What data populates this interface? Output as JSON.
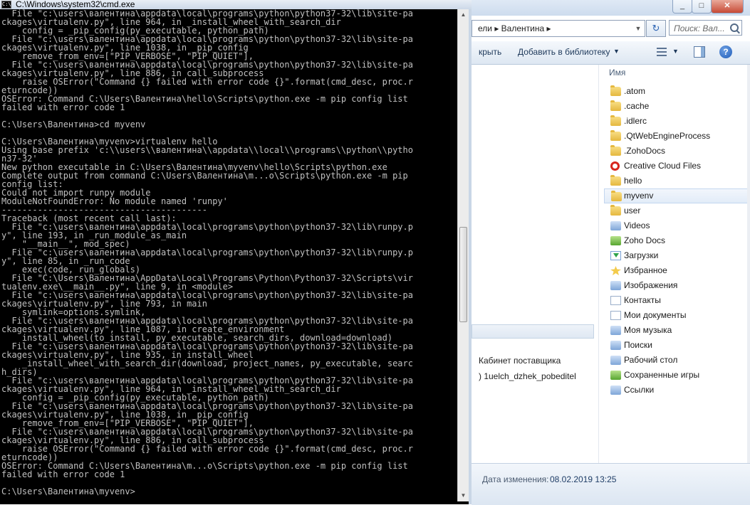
{
  "cmd": {
    "title": "C:\\Windows\\system32\\cmd.exe",
    "icon_label": "C:\\",
    "lines": [
      "  File \"c:\\users\\валентина\\appdata\\local\\programs\\python\\python37-32\\lib\\site-pa",
      "ckages\\virtualenv.py\", line 964, in _install_wheel_with_search_dir",
      "    config = _pip_config(py_executable, python_path)",
      "  File \"c:\\users\\валентина\\appdata\\local\\programs\\python\\python37-32\\lib\\site-pa",
      "ckages\\virtualenv.py\", line 1038, in _pip_config",
      "    remove_from_env=[\"PIP_VERBOSE\", \"PIP_QUIET\"],",
      "  File \"c:\\users\\валентина\\appdata\\local\\programs\\python\\python37-32\\lib\\site-pa",
      "ckages\\virtualenv.py\", line 886, in call_subprocess",
      "    raise OSError(\"Command {} failed with error code {}\".format(cmd_desc, proc.r",
      "eturncode))",
      "OSError: Command C:\\Users\\Валентина\\hello\\Scripts\\python.exe -m pip config list",
      "failed with error code 1",
      "",
      "C:\\Users\\Валентина>cd myvenv",
      "",
      "C:\\Users\\Валентина\\myvenv>virtualenv hello",
      "Using base prefix 'c:\\\\users\\\\валентина\\\\appdata\\\\local\\\\programs\\\\python\\\\pytho",
      "n37-32'",
      "New python executable in C:\\Users\\Валентина\\myvenv\\hello\\Scripts\\python.exe",
      "Complete output from command C:\\Users\\Валентина\\m...o\\Scripts\\python.exe -m pip",
      "config list:",
      "Could not import runpy module",
      "ModuleNotFoundError: No module named 'runpy'",
      "----------------------------------------",
      "Traceback (most recent call last):",
      "  File \"c:\\users\\валентина\\appdata\\local\\programs\\python\\python37-32\\lib\\runpy.p",
      "y\", line 193, in _run_module_as_main",
      "    \"__main__\", mod_spec)",
      "  File \"c:\\users\\валентина\\appdata\\local\\programs\\python\\python37-32\\lib\\runpy.p",
      "y\", line 85, in _run_code",
      "    exec(code, run_globals)",
      "  File \"C:\\Users\\Валентина\\AppData\\Local\\Programs\\Python\\Python37-32\\Scripts\\vir",
      "tualenv.exe\\__main__.py\", line 9, in <module>",
      "  File \"c:\\users\\валентина\\appdata\\local\\programs\\python\\python37-32\\lib\\site-pa",
      "ckages\\virtualenv.py\", line 793, in main",
      "    symlink=options.symlink,",
      "  File \"c:\\users\\валентина\\appdata\\local\\programs\\python\\python37-32\\lib\\site-pa",
      "ckages\\virtualenv.py\", line 1087, in create_environment",
      "    install_wheel(to_install, py_executable, search_dirs, download=download)",
      "  File \"c:\\users\\валентина\\appdata\\local\\programs\\python\\python37-32\\lib\\site-pa",
      "ckages\\virtualenv.py\", line 935, in install_wheel",
      "    _install_wheel_with_search_dir(download, project_names, py_executable, searc",
      "h_dirs)",
      "  File \"c:\\users\\валентина\\appdata\\local\\programs\\python\\python37-32\\lib\\site-pa",
      "ckages\\virtualenv.py\", line 964, in _install_wheel_with_search_dir",
      "    config = _pip_config(py_executable, python_path)",
      "  File \"c:\\users\\валентина\\appdata\\local\\programs\\python\\python37-32\\lib\\site-pa",
      "ckages\\virtualenv.py\", line 1038, in _pip_config",
      "    remove_from_env=[\"PIP_VERBOSE\", \"PIP_QUIET\"],",
      "  File \"c:\\users\\валентина\\appdata\\local\\programs\\python\\python37-32\\lib\\site-pa",
      "ckages\\virtualenv.py\", line 886, in call_subprocess",
      "    raise OSError(\"Command {} failed with error code {}\".format(cmd_desc, proc.r",
      "eturncode))",
      "OSError: Command C:\\Users\\Валентина\\m...o\\Scripts\\python.exe -m pip config list",
      "failed with error code 1",
      "",
      "C:\\Users\\Валентина\\myvenv>"
    ]
  },
  "explorer": {
    "address": "ели ▸ Валентина ▸",
    "search_placeholder": "Поиск: Вал...",
    "toolbar": {
      "open_label": "крыть",
      "library_label": "Добавить в библиотеку"
    },
    "column_name": "Имя",
    "nav_items": [
      "Кабинет поставщика",
      ") 1uelch_dzhek_pobeditel"
    ],
    "files": [
      {
        "name": ".atom",
        "icon": "folder-icon"
      },
      {
        "name": ".cache",
        "icon": "folder-icon"
      },
      {
        "name": ".idlerc",
        "icon": "folder-icon"
      },
      {
        "name": ".QtWebEngineProcess",
        "icon": "folder-icon"
      },
      {
        "name": ".ZohoDocs",
        "icon": "folder-icon"
      },
      {
        "name": "Creative Cloud Files",
        "icon": "creative-cloud-icon"
      },
      {
        "name": "hello",
        "icon": "folder-icon"
      },
      {
        "name": "myvenv",
        "icon": "folder-icon",
        "selected": true
      },
      {
        "name": "user",
        "icon": "folder-icon"
      },
      {
        "name": "Videos",
        "icon": "videos-folder-icon"
      },
      {
        "name": "Zoho Docs",
        "icon": "zoho-docs-icon"
      },
      {
        "name": "Загрузки",
        "icon": "downloads-folder-icon"
      },
      {
        "name": "Избранное",
        "icon": "favorites-folder-icon"
      },
      {
        "name": "Изображения",
        "icon": "pictures-folder-icon"
      },
      {
        "name": "Контакты",
        "icon": "contacts-folder-icon"
      },
      {
        "name": "Мои документы",
        "icon": "documents-folder-icon"
      },
      {
        "name": "Моя музыка",
        "icon": "music-folder-icon"
      },
      {
        "name": "Поиски",
        "icon": "searches-folder-icon"
      },
      {
        "name": "Рабочий стол",
        "icon": "desktop-folder-icon"
      },
      {
        "name": "Сохраненные игры",
        "icon": "saved-games-folder-icon"
      },
      {
        "name": "Ссылки",
        "icon": "links-folder-icon"
      }
    ],
    "status": {
      "label": "Дата изменения:",
      "value": "08.02.2019 13:25"
    }
  }
}
